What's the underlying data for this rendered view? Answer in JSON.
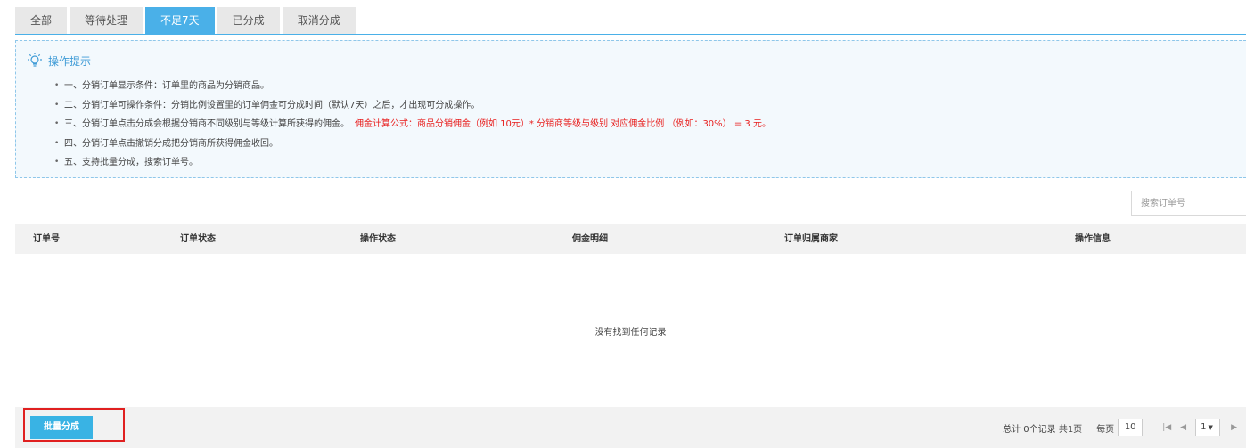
{
  "tabs": [
    {
      "label": "全部",
      "active": false
    },
    {
      "label": "等待处理",
      "active": false
    },
    {
      "label": "不足7天",
      "active": true
    },
    {
      "label": "已分成",
      "active": false
    },
    {
      "label": "取消分成",
      "active": false
    }
  ],
  "tips": {
    "title": "操作提示",
    "items": [
      {
        "text": "一、分销订单显示条件：订单里的商品为分销商品。",
        "highlight": ""
      },
      {
        "text": "二、分销订单可操作条件：分销比例设置里的订单佣金可分成时间（默认7天）之后，才出现可分成操作。",
        "highlight": ""
      },
      {
        "text": "三、分销订单点击分成会根据分销商不同级别与等级计算所获得的佣金。",
        "highlight": "佣金计算公式：商品分销佣金（例如 10元）* 分销商等级与级别 对应佣金比例 （例如：30%） = 3 元。"
      },
      {
        "text": "四、分销订单点击撤销分成把分销商所获得佣金收回。",
        "highlight": ""
      },
      {
        "text": "五、支持批量分成，搜索订单号。",
        "highlight": ""
      }
    ]
  },
  "search": {
    "placeholder": "搜索订单号",
    "value": ""
  },
  "table": {
    "columns": [
      "订单号",
      "订单状态",
      "操作状态",
      "佣金明细",
      "订单归属商家",
      "操作信息"
    ],
    "rows": [],
    "empty_text": "没有找到任何记录"
  },
  "footer": {
    "batch_button": "批量分成",
    "summary": "总计 0个记录 共1页",
    "per_page_label": "每页",
    "page_size": "10",
    "current_page": "1"
  },
  "colors": {
    "accent": "#4ab0e8",
    "button": "#39b3e4",
    "highlight_border": "#e02020",
    "warning_text": "#e8201f"
  }
}
